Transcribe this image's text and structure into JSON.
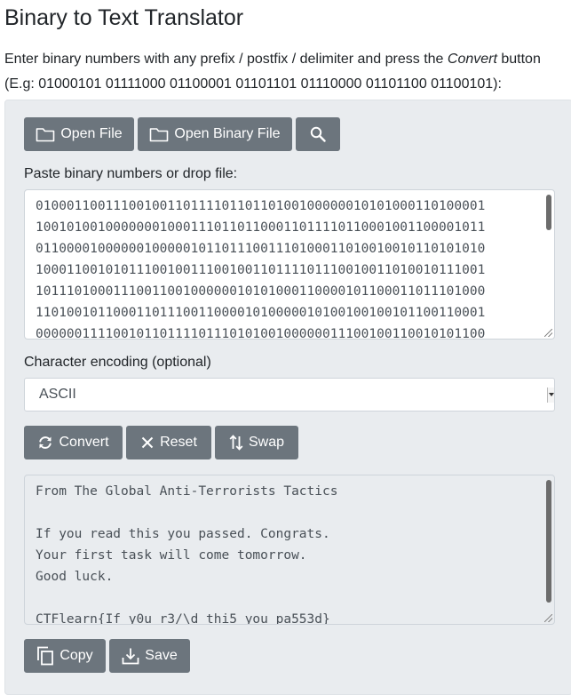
{
  "page": {
    "title": "Binary to Text Translator",
    "intro_before": "Enter binary numbers with any prefix / postfix / delimiter and press the ",
    "intro_em": "Convert",
    "intro_after": " button",
    "intro_example": "(E.g: 01000101 01111000 01100001 01101101 01110000 01101100 01100101):"
  },
  "toolbar": {
    "open_file": "Open File",
    "open_binary_file": "Open Binary File"
  },
  "input": {
    "label": "Paste binary numbers or drop file:",
    "value": "0100011001110010011011110110110100100000010101000110100001\n1001010010000000100011101101100011011110110001001100001011\n0110000100000010000010110111001110100011010010010110101010\n1000110010101110010011100100110111101110010011010010111001\n1011101000111001100100000010101000110000101100011011101000\n1101001011000110111001100001010000010100100100101100110001\n0000001111001011011110111010100100000011100100110010101100"
  },
  "encoding": {
    "label": "Character encoding (optional)",
    "selected": "ASCII"
  },
  "actions": {
    "convert": "Convert",
    "reset": "Reset",
    "swap": "Swap"
  },
  "output": {
    "value": "From The Global Anti-Terrorists Tactics\n\nIf you read this you passed. Congrats.\nYour first task will come tomorrow.\nGood luck.\n\nCTFlearn{If_y0u_r3/\\d_thi5_you_pa553d}"
  },
  "bottom": {
    "copy": "Copy",
    "save": "Save"
  },
  "icons": {
    "folder": "folder-icon",
    "search": "search-icon",
    "refresh": "refresh-icon",
    "close": "x-icon",
    "swap": "swap-icon",
    "copy": "copy-icon",
    "download": "download-icon"
  },
  "colors": {
    "button_bg": "#6c757d",
    "panel_bg": "#e9ecef"
  }
}
